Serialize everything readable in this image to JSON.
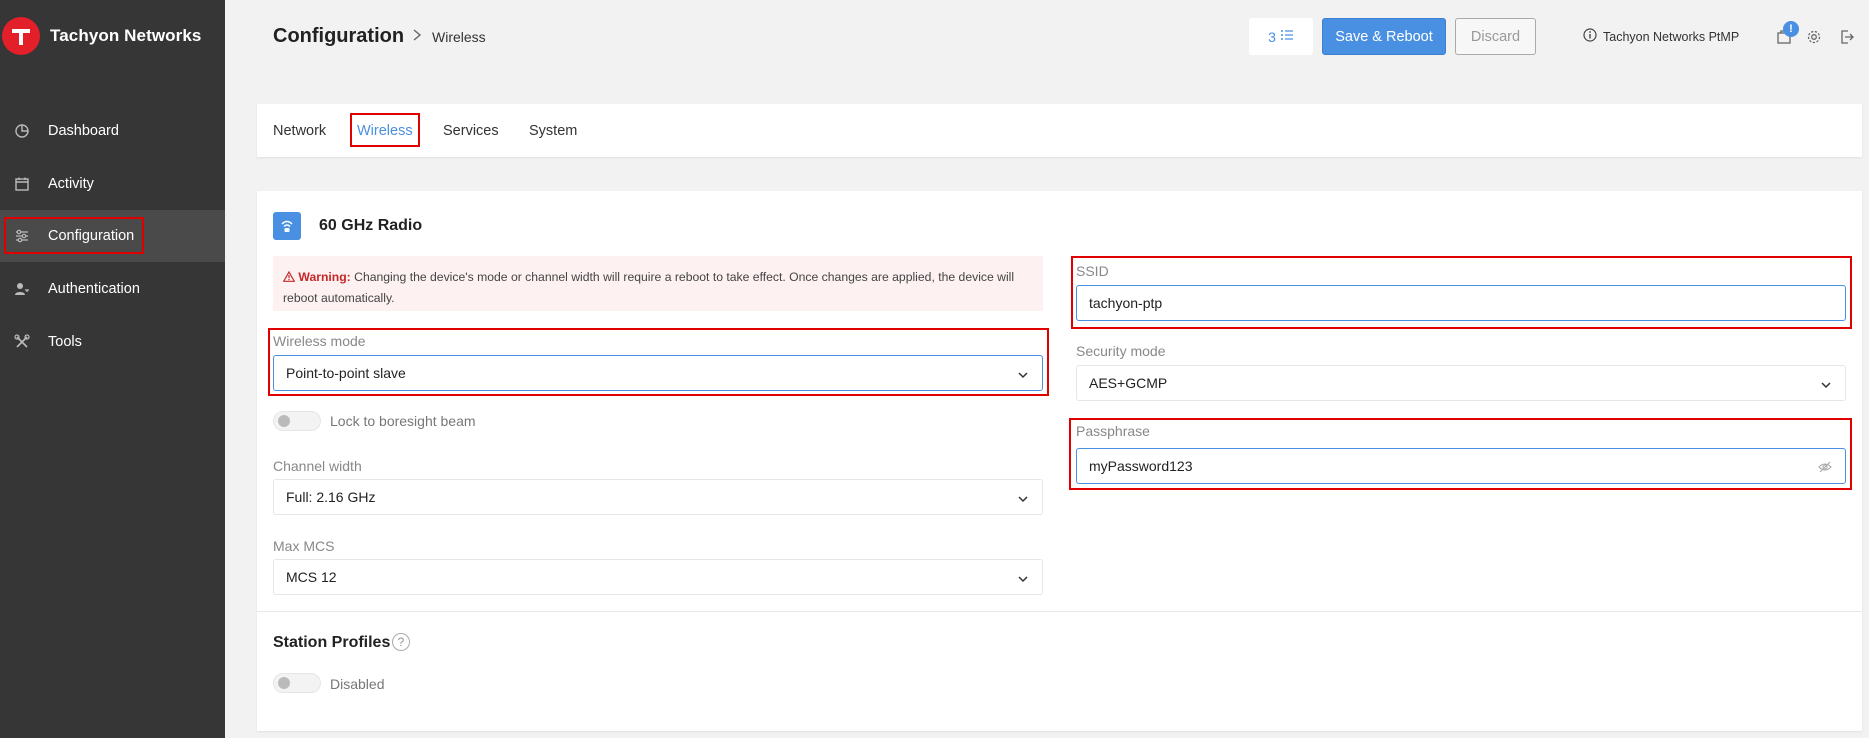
{
  "app": {
    "name": "Tachyon Networks",
    "logo_letter": "T",
    "brand_color": "#e3202a"
  },
  "sidebar": {
    "items": [
      {
        "label": "Dashboard",
        "icon": "pie-chart-icon"
      },
      {
        "label": "Activity",
        "icon": "calendar-icon"
      },
      {
        "label": "Configuration",
        "icon": "sliders-icon",
        "active": true
      },
      {
        "label": "Authentication",
        "icon": "user-key-icon"
      },
      {
        "label": "Tools",
        "icon": "tools-icon"
      }
    ]
  },
  "header": {
    "title": "Configuration",
    "subtitle": "Wireless",
    "changes_count": "3",
    "save_label": "Save & Reboot",
    "discard_label": "Discard",
    "device_name": "Tachyon Networks PtMP",
    "notification_badge": "!",
    "accent_color": "#4a90e2"
  },
  "tabs": [
    {
      "label": "Network"
    },
    {
      "label": "Wireless",
      "active": true
    },
    {
      "label": "Services"
    },
    {
      "label": "System"
    }
  ],
  "radio": {
    "title": "60 GHz Radio",
    "warning_label": "Warning:",
    "warning_text": "Changing the device's mode or channel width will require a reboot to take effect. Once changes are applied, the device will reboot automatically.",
    "wireless_mode_label": "Wireless mode",
    "wireless_mode_value": "Point-to-point slave",
    "boresight_label": "Lock to boresight beam",
    "boresight_enabled": false,
    "channel_width_label": "Channel width",
    "channel_width_value": "Full: 2.16 GHz",
    "max_mcs_label": "Max MCS",
    "max_mcs_value": "MCS 12",
    "ssid_label": "SSID",
    "ssid_value": "tachyon-ptp",
    "security_mode_label": "Security mode",
    "security_mode_value": "AES+GCMP",
    "passphrase_label": "Passphrase",
    "passphrase_value": "myPassword123"
  },
  "station_profiles": {
    "title": "Station Profiles",
    "help": "?",
    "toggle_label": "Disabled",
    "enabled": false
  }
}
